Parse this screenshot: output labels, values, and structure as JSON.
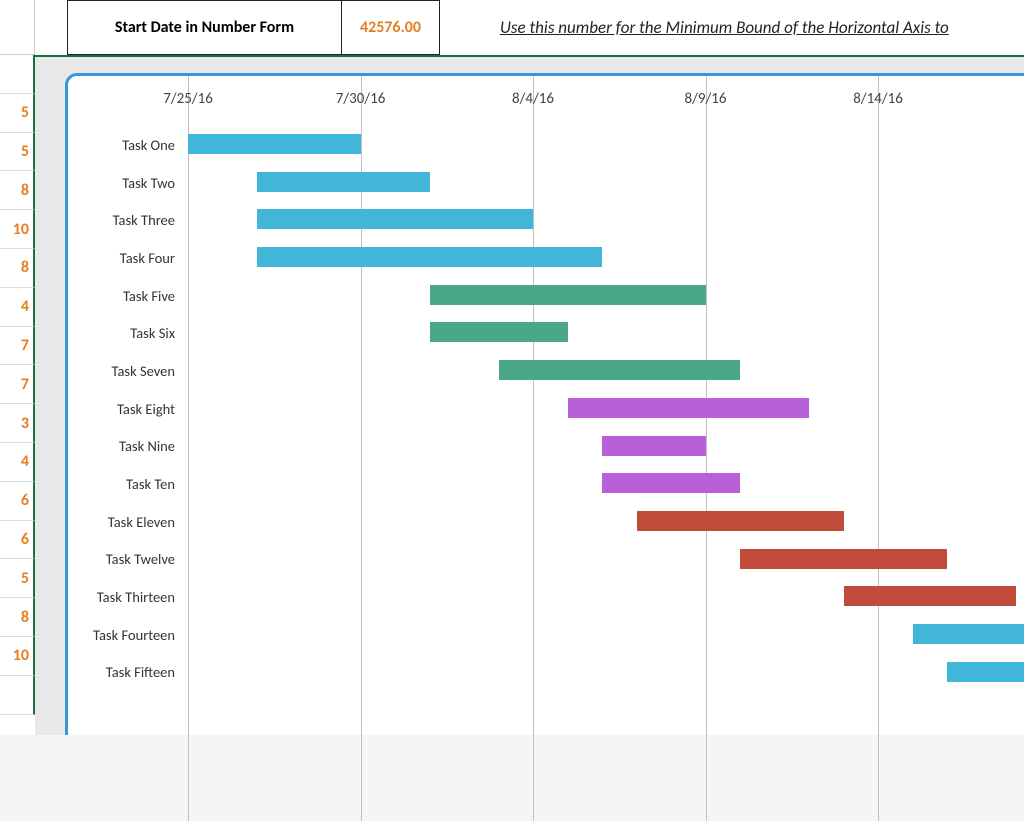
{
  "header": {
    "label": "Start Date in Number Form",
    "value": "42576.00",
    "hint": "Use this number for the Minimum Bound of the Horizontal Axis to"
  },
  "left_values": [
    "",
    "5",
    "5",
    "8",
    "10",
    "8",
    "4",
    "7",
    "7",
    "3",
    "4",
    "6",
    "6",
    "5",
    "8",
    "10",
    ""
  ],
  "x_ticks": [
    "7/25/16",
    "7/30/16",
    "8/4/16",
    "8/9/16",
    "8/14/16"
  ],
  "tasks": [
    {
      "name": "Task One"
    },
    {
      "name": "Task Two"
    },
    {
      "name": "Task Three"
    },
    {
      "name": "Task Four"
    },
    {
      "name": "Task Five"
    },
    {
      "name": "Task Six"
    },
    {
      "name": "Task Seven"
    },
    {
      "name": "Task Eight"
    },
    {
      "name": "Task Nine"
    },
    {
      "name": "Task Ten"
    },
    {
      "name": "Task Eleven"
    },
    {
      "name": "Task Twelve"
    },
    {
      "name": "Task Thirteen"
    },
    {
      "name": "Task Fourteen"
    },
    {
      "name": "Task Fifteen"
    }
  ],
  "colors": {
    "blue": "#42b6d8",
    "green": "#4aa787",
    "purple": "#b860d7",
    "red": "#c24c3b"
  },
  "chart_data": {
    "type": "bar",
    "orientation": "horizontal",
    "title": "",
    "xlabel": "",
    "ylabel": "",
    "x_axis_dates": [
      "7/25/16",
      "7/30/16",
      "8/4/16",
      "8/9/16",
      "8/14/16"
    ],
    "x_axis_serial": [
      42576,
      42581,
      42586,
      42591,
      42596
    ],
    "x_min_serial": 42576,
    "series": [
      {
        "name": "Task One",
        "start": "7/25/16",
        "start_serial": 42576,
        "duration": 5,
        "end_serial": 42581,
        "color": "blue"
      },
      {
        "name": "Task Two",
        "start": "7/27/16",
        "start_serial": 42578,
        "duration": 5,
        "end_serial": 42583,
        "color": "blue"
      },
      {
        "name": "Task Three",
        "start": "7/27/16",
        "start_serial": 42578,
        "duration": 8,
        "end_serial": 42586,
        "color": "blue"
      },
      {
        "name": "Task Four",
        "start": "7/27/16",
        "start_serial": 42578,
        "duration": 10,
        "end_serial": 42588,
        "color": "blue"
      },
      {
        "name": "Task Five",
        "start": "8/1/16",
        "start_serial": 42583,
        "duration": 8,
        "end_serial": 42591,
        "color": "green"
      },
      {
        "name": "Task Six",
        "start": "8/1/16",
        "start_serial": 42583,
        "duration": 4,
        "end_serial": 42587,
        "color": "green"
      },
      {
        "name": "Task Seven",
        "start": "8/3/16",
        "start_serial": 42585,
        "duration": 7,
        "end_serial": 42592,
        "color": "green"
      },
      {
        "name": "Task Eight",
        "start": "8/5/16",
        "start_serial": 42587,
        "duration": 7,
        "end_serial": 42594,
        "color": "purple"
      },
      {
        "name": "Task Nine",
        "start": "8/6/16",
        "start_serial": 42588,
        "duration": 3,
        "end_serial": 42591,
        "color": "purple"
      },
      {
        "name": "Task Ten",
        "start": "8/6/16",
        "start_serial": 42588,
        "duration": 4,
        "end_serial": 42592,
        "color": "purple"
      },
      {
        "name": "Task Eleven",
        "start": "8/7/16",
        "start_serial": 42589,
        "duration": 6,
        "end_serial": 42595,
        "color": "red"
      },
      {
        "name": "Task Twelve",
        "start": "8/10/16",
        "start_serial": 42592,
        "duration": 6,
        "end_serial": 42598,
        "color": "red"
      },
      {
        "name": "Task Thirteen",
        "start": "8/13/16",
        "start_serial": 42595,
        "duration": 5,
        "end_serial": 42600,
        "color": "red"
      },
      {
        "name": "Task Fourteen",
        "start": "8/15/16",
        "start_serial": 42597,
        "duration": 8,
        "end_serial": 42605,
        "color": "blue"
      },
      {
        "name": "Task Fifteen",
        "start": "8/16/16",
        "start_serial": 42598,
        "duration": 10,
        "end_serial": 42608,
        "color": "blue"
      }
    ]
  }
}
